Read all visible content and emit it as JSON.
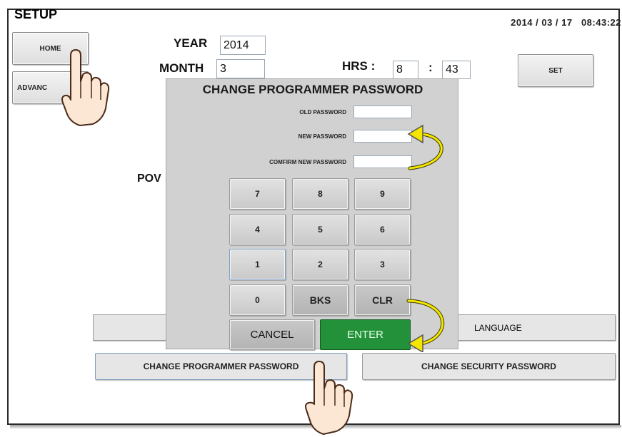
{
  "screen": {
    "title": "SETUP",
    "datetime": "2014 / 03 / 17   08:43:22"
  },
  "sidebar": {
    "home_label": "HOME",
    "advanced_label": "ADVANC"
  },
  "date_time_setup": {
    "year_label": "YEAR",
    "year_value": "2014",
    "month_label": "MONTH",
    "month_value": "3",
    "hrs_label": "HRS :",
    "hours_value": "8",
    "colon": ":",
    "minutes_value": "43",
    "set_label": "SET"
  },
  "background_text": {
    "power_partial": "POV"
  },
  "bottom_buttons": {
    "language_label": "LANGUAGE",
    "change_programmer_password": "CHANGE PROGRAMMER PASSWORD",
    "change_security_password": "CHANGE SECURITY PASSWORD"
  },
  "dialog": {
    "title": "CHANGE PROGRAMMER PASSWORD",
    "old_password_label": "OLD PASSWORD",
    "new_password_label": "NEW PASSWORD",
    "confirm_password_label": "COMFIRM NEW PASSWORD",
    "old_password_value": "",
    "new_password_value": "",
    "confirm_password_value": "",
    "keys": {
      "k7": "7",
      "k8": "8",
      "k9": "9",
      "k4": "4",
      "k5": "5",
      "k6": "6",
      "k1": "1",
      "k2": "2",
      "k3": "3",
      "k0": "0",
      "bks": "BKS",
      "clr": "CLR"
    },
    "cancel_label": "CANCEL",
    "enter_label": "ENTER"
  },
  "colors": {
    "enter_green": "#22913a",
    "arrow_yellow": "#f5e600",
    "frame_border": "#2b2b2b",
    "dialog_bg": "#d1d1d1"
  },
  "icons": [
    "hand-pointer-icon",
    "curved-arrow-icon"
  ]
}
